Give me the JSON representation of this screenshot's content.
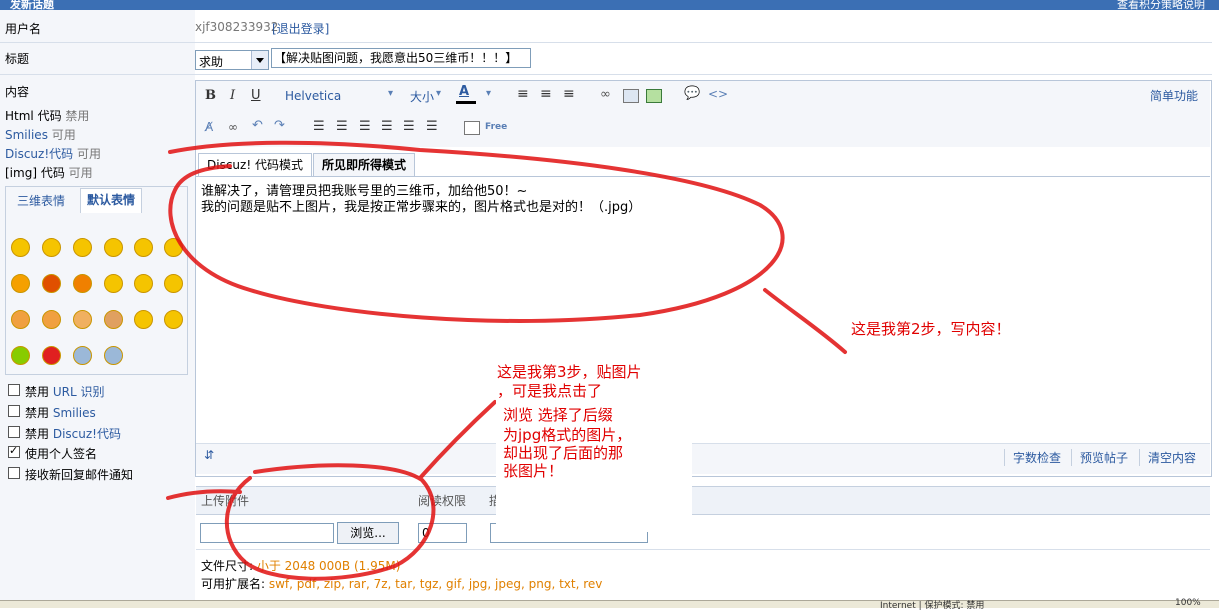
{
  "header": {
    "title": "发新话题",
    "right_link": "查看积分策略说明"
  },
  "form": {
    "username_label": "用户名",
    "username": "xjf308233932",
    "logout_link": "[退出登录]",
    "title_label": "标题",
    "category_value": "求助",
    "title_value": "【解决贴图问题，我愿意出50三维币！！！】",
    "content_label": "内容"
  },
  "perms": [
    {
      "name": "Html 代码",
      "state": "禁用"
    },
    {
      "name": "Smilies",
      "state": "可用"
    },
    {
      "name": "Discuz!代码",
      "state": "可用"
    },
    {
      "name": "[img] 代码",
      "state": "可用"
    }
  ],
  "smilies": {
    "tab_3d": "三维表情",
    "tab_default": "默认表情"
  },
  "options": [
    {
      "label_pre": "禁用 ",
      "label_link": "URL 识别",
      "checked": false
    },
    {
      "label_pre": "禁用 ",
      "label_link": "Smilies",
      "checked": false
    },
    {
      "label_pre": "禁用 ",
      "label_link": "Discuz!代码",
      "checked": false
    },
    {
      "label_pre": "使用个人签名",
      "label_link": "",
      "checked": true
    },
    {
      "label_pre": "接收新回复邮件通知",
      "label_link": "",
      "checked": false
    }
  ],
  "toolbar": {
    "bold": "B",
    "italic": "I",
    "underline": "U",
    "font": "Helvetica",
    "size": "大小",
    "simple_mode": "简单功能"
  },
  "editor": {
    "mode_discuz": "Discuz! 代码模式",
    "mode_wysiwyg": "所见即所得模式",
    "line1": "谁解决了，请管理员把我账号里的三维币，加给他50！~",
    "line2": "我的问题是贴不上图片，我是按正常步骤来的，图片格式也是对的！（.jpg）",
    "btn_check": "字数检查",
    "btn_preview": "预览帖子",
    "btn_clear": "清空内容"
  },
  "attach": {
    "upload_label": "上传附件",
    "read_perm_label": "阅读权限",
    "desc_label": "描",
    "browse_button": "浏览...",
    "perm_value": "0",
    "size_label": "文件尺寸: ",
    "size_value": "小于 2048 000B (1.95M)",
    "ext_label": "可用扩展名: ",
    "ext_value": "swf, pdf, zip, rar, 7z, tar, tgz, gif, jpg, jpeg, png, txt, rev"
  },
  "notes": {
    "step2": "这是我第2步，写内容！",
    "step3_line1": "这是我第3步，贴图片",
    "step3_line2": "，可是我点击了",
    "step3_line3": "浏览   选择了后缀",
    "step3_line4": "为jpg格式的图片，",
    "step3_line5": "却出现了后面的那",
    "step3_line6": "张图片！"
  },
  "statusbar": {
    "zone": "Internet | 保护模式: 禁用",
    "zoom": "100%"
  }
}
